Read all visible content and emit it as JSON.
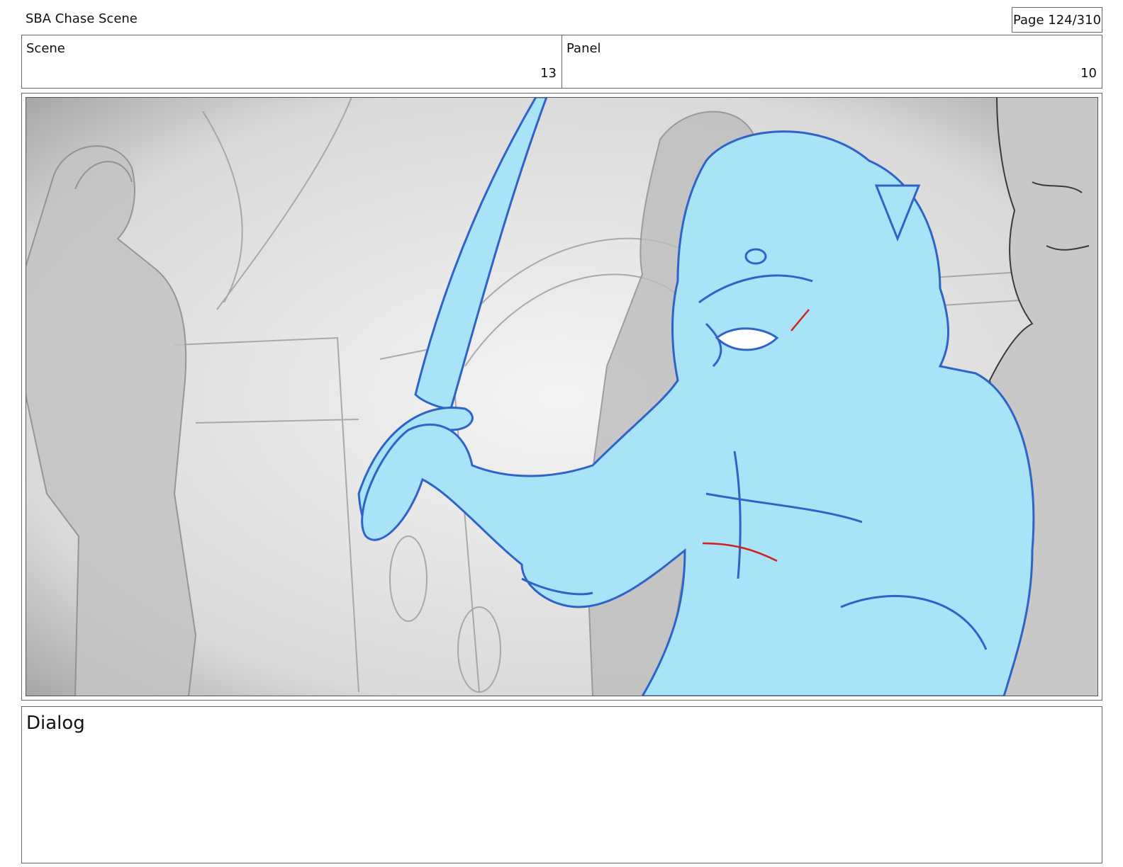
{
  "header": {
    "title": "SBA Chase Scene",
    "page": "Page 124/310"
  },
  "info": {
    "scene_label": "Scene",
    "scene_value": "13",
    "panel_label": "Panel",
    "panel_value": "10"
  },
  "panel": {
    "description_colors": {
      "background": "#e9e9e9",
      "figure_fill": "#a9e3f7",
      "figure_line": "#2f63c9",
      "accent_red": "#d42020",
      "sketch_gray": "#8a8a8a"
    }
  },
  "dialog": {
    "label": "Dialog"
  }
}
